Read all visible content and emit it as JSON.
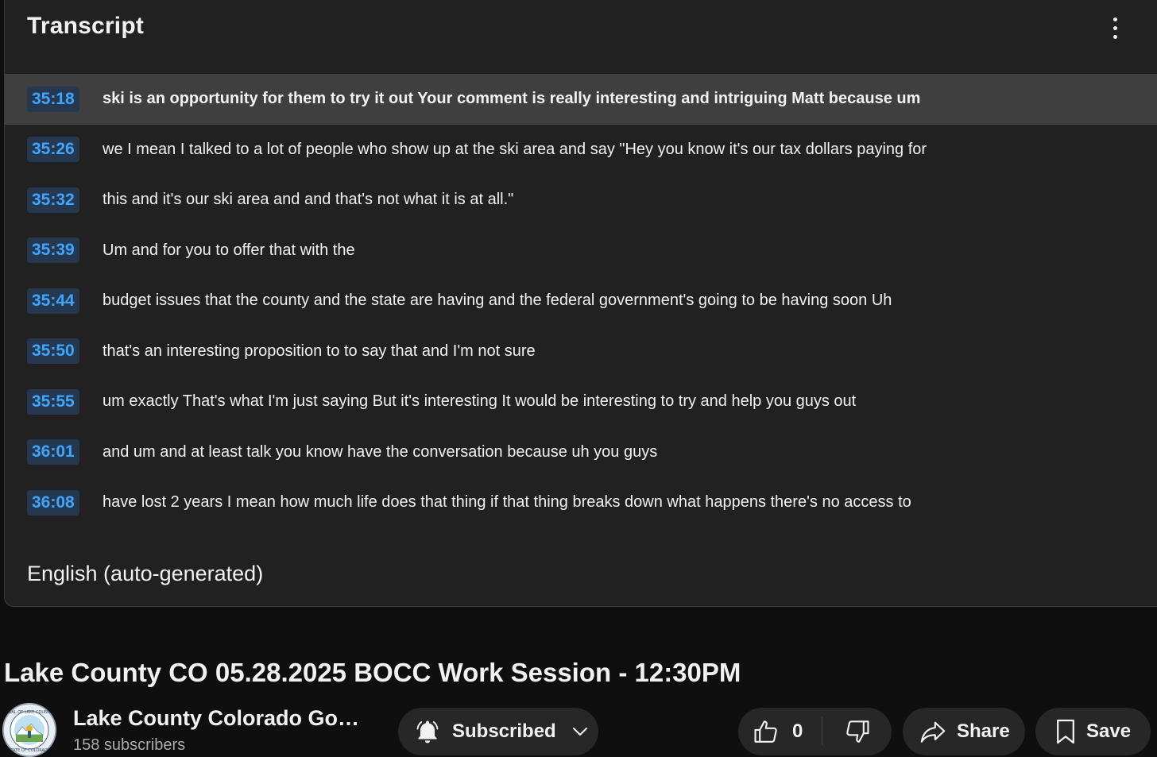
{
  "transcript": {
    "title": "Transcript",
    "language": "English (auto-generated)",
    "segments": [
      {
        "time": "35:18",
        "text": "ski is an opportunity for them to try it out Your comment is really interesting and intriguing Matt because um"
      },
      {
        "time": "35:26",
        "text": "we I mean I talked to a lot of people who show up at the ski area and say \"Hey you know it's our tax dollars paying for"
      },
      {
        "time": "35:32",
        "text": "this and it's our ski area and and that's not what it is at all.\""
      },
      {
        "time": "35:39",
        "text": "Um and for you to offer that with the"
      },
      {
        "time": "35:44",
        "text": "budget issues that the county and the state are having and the federal government's going to be having soon Uh"
      },
      {
        "time": "35:50",
        "text": "that's an interesting proposition to to say that and I'm not sure"
      },
      {
        "time": "35:55",
        "text": "um exactly That's what I'm just saying But it's interesting It would be interesting to try and help you guys out"
      },
      {
        "time": "36:01",
        "text": "and um and at least talk you know have the conversation because uh you guys"
      },
      {
        "time": "36:08",
        "text": "have lost 2 years I mean how much life does that thing if that thing breaks down what happens there's no access to"
      }
    ]
  },
  "video": {
    "title": "Lake County CO 05.28.2025 BOCC Work Session - 12:30PM"
  },
  "channel": {
    "name": "Lake County Colorado Gover...",
    "subscribers": "158 subscribers"
  },
  "actions": {
    "subscribed_label": "Subscribed",
    "like_count": "0",
    "share_label": "Share",
    "save_label": "Save"
  },
  "icons": {
    "more": "more-vert-icon",
    "bell": "bell-icon",
    "chevron": "chevron-down-icon",
    "like": "thumbs-up-icon",
    "dislike": "thumbs-down-icon",
    "share": "share-arrow-icon",
    "save": "bookmark-icon"
  },
  "colors": {
    "timestamp": "#3ea6ff",
    "active_row": "#3f3f3f",
    "panel": "#212121",
    "background": "#0f0f0f"
  }
}
